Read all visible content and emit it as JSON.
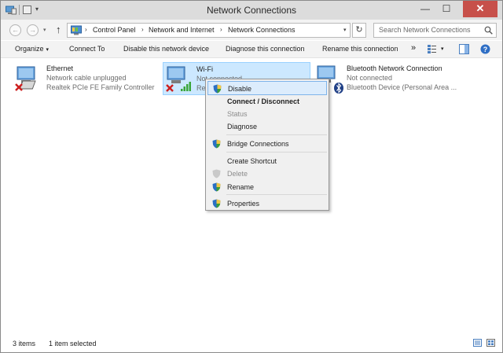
{
  "window": {
    "title": "Network Connections",
    "minimize_glyph": "—",
    "maximize_glyph": "☐",
    "close_glyph": "✕"
  },
  "nav": {
    "back_glyph": "←",
    "forward_glyph": "→",
    "history_glyph": "▾",
    "up_glyph": "↑",
    "breadcrumb": [
      "Control Panel",
      "Network and Internet",
      "Network Connections"
    ],
    "breadcrumb_sep": "›",
    "dropdown_glyph": "▾",
    "refresh_glyph": "↻",
    "search_placeholder": "Search Network Connections"
  },
  "toolbar": {
    "organize": "Organize",
    "caret": "▾",
    "commands": [
      "Connect To",
      "Disable this network device",
      "Diagnose this connection",
      "Rename this connection"
    ],
    "more": "»",
    "help": "?"
  },
  "connections": [
    {
      "name": "Ethernet",
      "status": "Network cable unplugged",
      "device": "Realtek PCIe FE Family Controller",
      "icon": "ethernet-adapter-icon",
      "selected": false
    },
    {
      "name": "Wi-Fi",
      "status": "Not connected",
      "device": "Re",
      "icon": "wifi-adapter-icon",
      "selected": true
    },
    {
      "name": "Bluetooth Network Connection",
      "status": "Not connected",
      "device": "Bluetooth Device (Personal Area ...",
      "icon": "bluetooth-adapter-icon",
      "selected": false
    }
  ],
  "context_menu": {
    "items": [
      {
        "label": "Disable",
        "icon": "uac-shield-icon",
        "style": "highlighted"
      },
      {
        "label": "Connect / Disconnect",
        "icon": null,
        "style": "bold"
      },
      {
        "label": "Status",
        "icon": null,
        "style": "disabled"
      },
      {
        "label": "Diagnose",
        "icon": null,
        "style": "normal"
      },
      {
        "label": "Bridge Connections",
        "icon": "uac-shield-icon",
        "style": "normal"
      },
      {
        "label": "Create Shortcut",
        "icon": null,
        "style": "normal"
      },
      {
        "label": "Delete",
        "icon": "uac-shield-icon",
        "style": "disabled"
      },
      {
        "label": "Rename",
        "icon": "uac-shield-icon",
        "style": "normal"
      },
      {
        "label": "Properties",
        "icon": "uac-shield-icon",
        "style": "normal"
      }
    ]
  },
  "statusbar": {
    "item_count": "3 items",
    "selection": "1 item selected"
  },
  "colors": {
    "selection_bg": "#cce8ff",
    "menu_highlight": "#dcecfc",
    "close_button": "#c7504a",
    "shield_blue": "#2b6fc4",
    "shield_green": "#3a9d3a"
  }
}
